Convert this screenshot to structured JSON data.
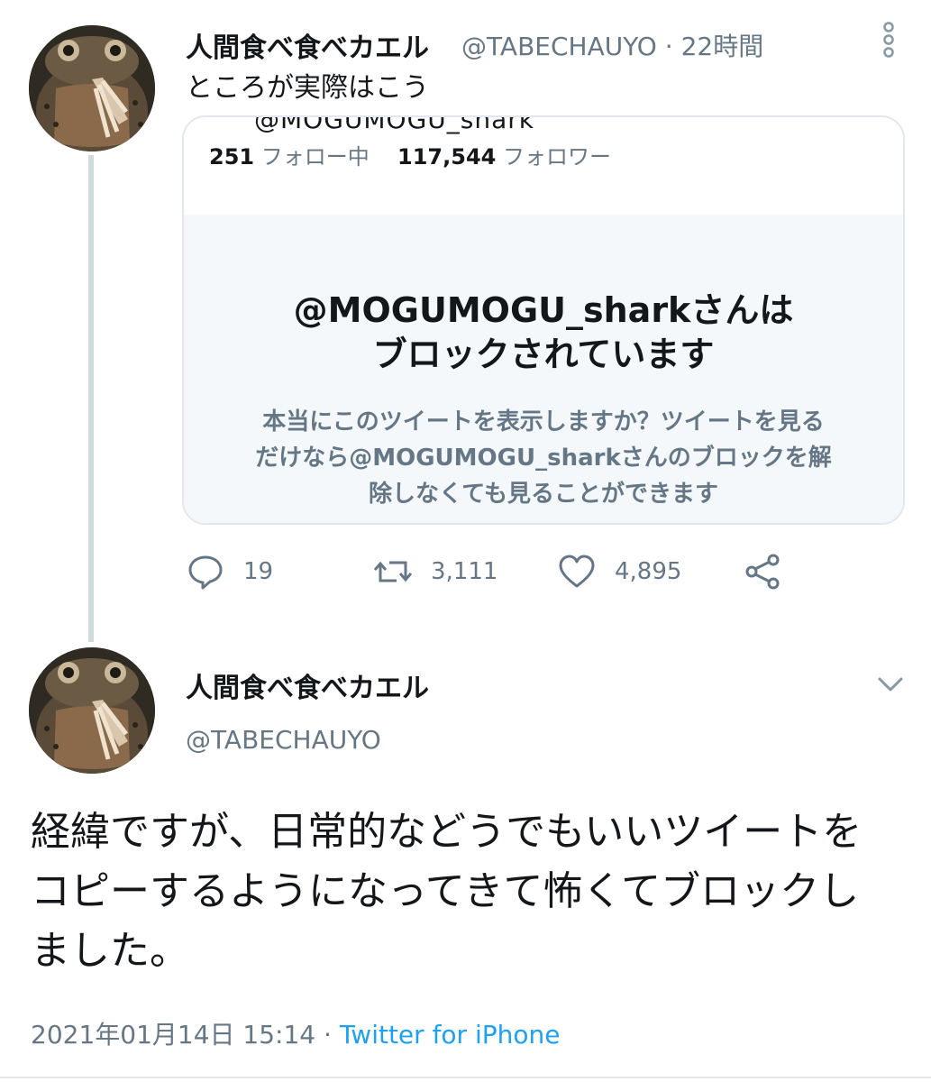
{
  "tweet1": {
    "display_name": "人間食べ食べカエル",
    "handle": "@TABECHAUYO",
    "separator": "·",
    "time": "22時間",
    "text": "ところが実際はこう",
    "quoted": {
      "cut_handle": "@MOGUMOGU_shark",
      "following_count": "251",
      "following_label": "フォロー中",
      "followers_count": "117,544",
      "followers_label": "フォロワー",
      "blocked_title_line1": "@MOGUMOGU_sharkさんは",
      "blocked_title_line2": "ブロックされています",
      "blocked_desc": "本当にこのツイートを表示しますか？ツイートを見るだけなら@MOGUMOGU_sharkさんのブロックを解除しなくても見ることができます"
    },
    "actions": {
      "reply_icon": "reply-icon",
      "reply_count": "19",
      "retweet_icon": "retweet-icon",
      "retweet_count": "3,111",
      "like_icon": "heart-icon",
      "like_count": "4,895",
      "share_icon": "share-icon"
    }
  },
  "tweet2": {
    "display_name": "人間食べ食べカエル",
    "handle": "@TABECHAUYO",
    "body": "経緯ですが、日常的などうでもいいツイートをコピーするようになってきて怖くてブロックしました。",
    "datetime": "2021年01月14日 15:14",
    "separator": "·",
    "source": "Twitter for iPhone"
  },
  "colors": {
    "text": "#14171a",
    "secondary": "#657786",
    "link": "#1da1f2",
    "border": "#e1e8ed",
    "card_gray": "#f5f8fa"
  }
}
